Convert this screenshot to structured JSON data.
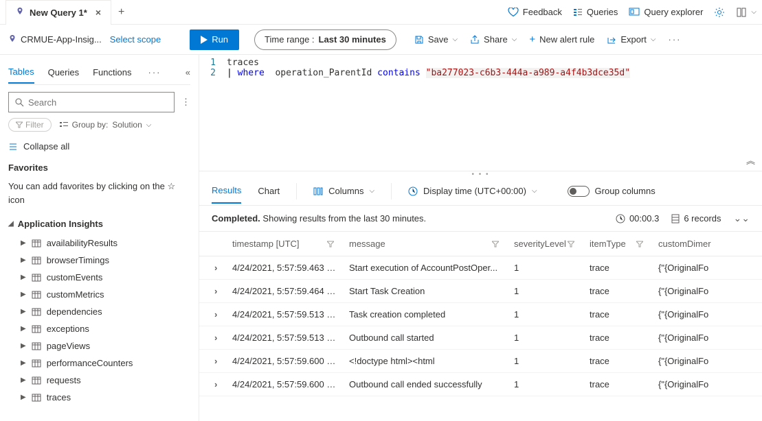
{
  "tabs": {
    "active": "New Query 1*"
  },
  "topActions": {
    "feedback": "Feedback",
    "queries": "Queries",
    "explorer": "Query explorer"
  },
  "scope": {
    "name": "CRMUE-App-Insig...",
    "select": "Select scope"
  },
  "run": "Run",
  "timeRange": {
    "label": "Time range :",
    "value": "Last 30 minutes"
  },
  "barActions": {
    "save": "Save",
    "share": "Share",
    "newAlert": "New alert rule",
    "export": "Export"
  },
  "sidebar": {
    "tabs": [
      "Tables",
      "Queries",
      "Functions"
    ],
    "searchPlaceholder": "Search",
    "filter": "Filter",
    "groupByLabel": "Group by:",
    "groupByValue": "Solution",
    "collapseAll": "Collapse all",
    "favoritesHead": "Favorites",
    "favoritesText": "You can add favorites by clicking on the ☆ icon",
    "treeHead": "Application Insights",
    "treeItems": [
      "availabilityResults",
      "browserTimings",
      "customEvents",
      "customMetrics",
      "dependencies",
      "exceptions",
      "pageViews",
      "performanceCounters",
      "requests",
      "traces"
    ]
  },
  "editor": {
    "lines": [
      "1",
      "2"
    ],
    "l1": "traces",
    "l2pipe": "|",
    "l2where": "where",
    "l2field": "operation_ParentId",
    "l2contains": "contains",
    "l2str": "\"ba277023-c6b3-444a-a989-a4f4b3dce35d\""
  },
  "results": {
    "tabs": {
      "results": "Results",
      "chart": "Chart"
    },
    "columnsLabel": "Columns",
    "displayTime": "Display time (UTC+00:00)",
    "groupCols": "Group columns",
    "statusBold": "Completed.",
    "statusRest": "Showing results from the last 30 minutes.",
    "elapsed": "00:00.3",
    "records": "6 records",
    "headers": {
      "timestamp": "timestamp [UTC]",
      "message": "message",
      "severity": "severityLevel",
      "itemType": "itemType",
      "custom": "customDimer"
    },
    "rows": [
      {
        "ts": "4/24/2021, 5:57:59.463 P...",
        "msg": "Start execution of AccountPostOper...",
        "sev": "1",
        "type": "trace",
        "cd": "{\"{OriginalFo"
      },
      {
        "ts": "4/24/2021, 5:57:59.464 P...",
        "msg": "Start Task Creation",
        "sev": "1",
        "type": "trace",
        "cd": "{\"{OriginalFo"
      },
      {
        "ts": "4/24/2021, 5:57:59.513 PM",
        "msg": "Task creation completed",
        "sev": "1",
        "type": "trace",
        "cd": "{\"{OriginalFo"
      },
      {
        "ts": "4/24/2021, 5:57:59.513 PM",
        "msg": "Outbound call started",
        "sev": "1",
        "type": "trace",
        "cd": "{\"{OriginalFo"
      },
      {
        "ts": "4/24/2021, 5:57:59.600 P...",
        "msg": "<!doctype html><html",
        "sev": "1",
        "type": "trace",
        "cd": "{\"{OriginalFo"
      },
      {
        "ts": "4/24/2021, 5:57:59.600 P...",
        "msg": "Outbound call ended successfully",
        "sev": "1",
        "type": "trace",
        "cd": "{\"{OriginalFo"
      }
    ]
  }
}
